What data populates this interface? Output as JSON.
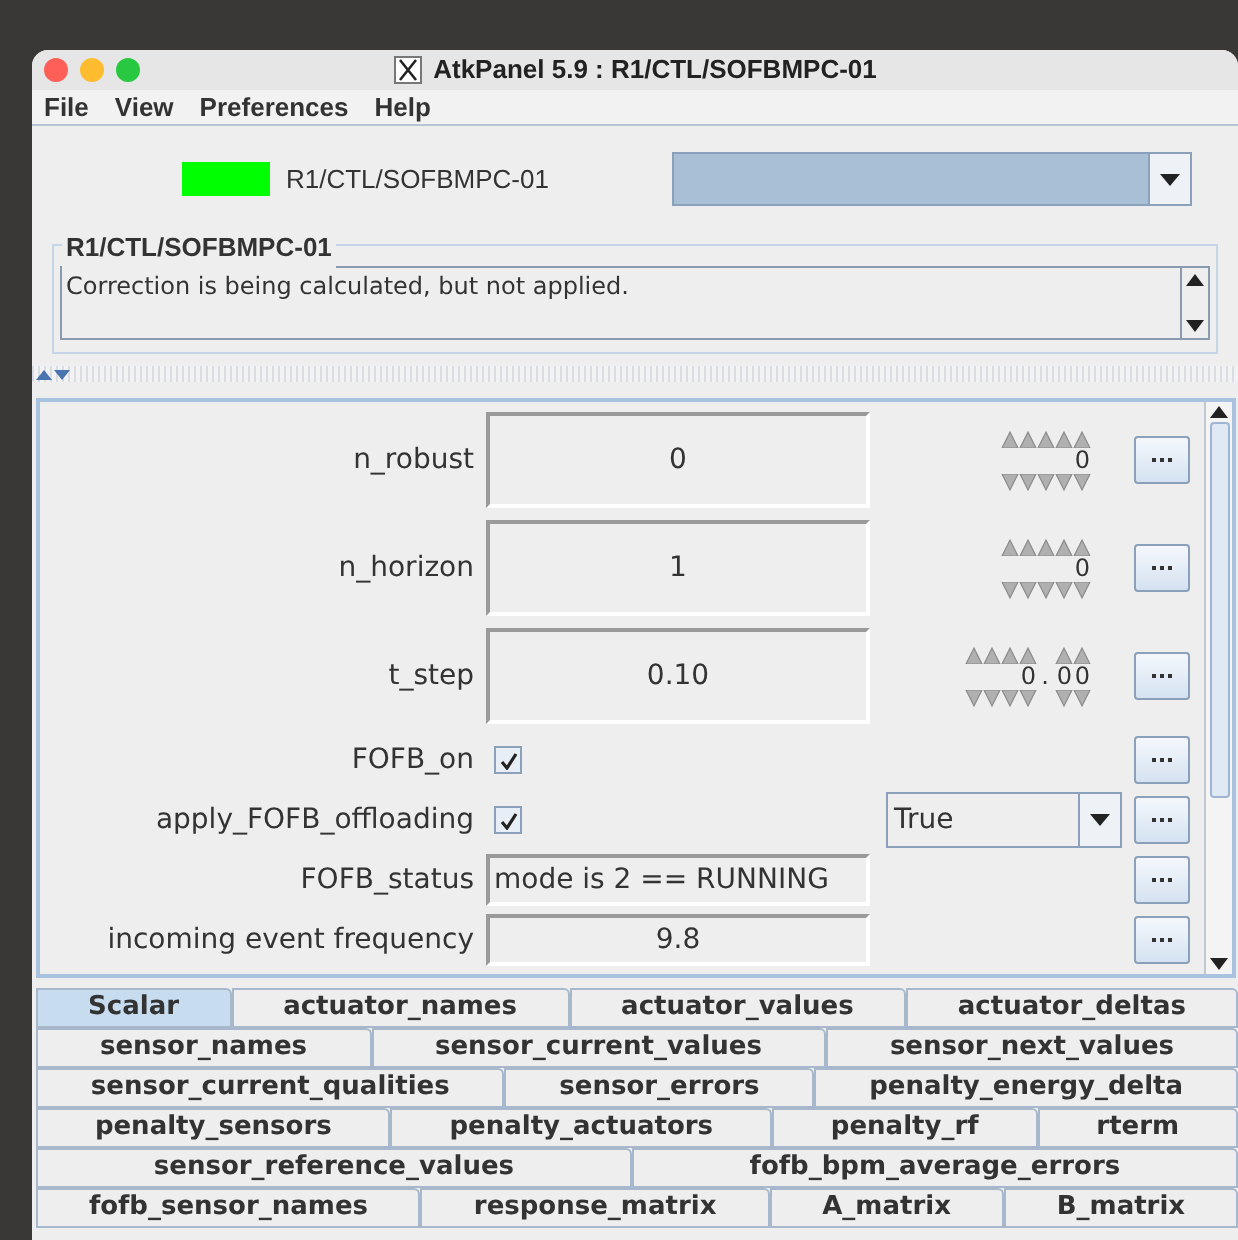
{
  "window": {
    "title": "AtkPanel 5.9 : R1/CTL/SOFBMPC-01"
  },
  "menu": [
    "File",
    "View",
    "Preferences",
    "Help"
  ],
  "device": {
    "name": "R1/CTL/SOFBMPC-01",
    "color": "#00ff00"
  },
  "status_box": {
    "title": "R1/CTL/SOFBMPC-01",
    "text": "Correction is being calculated, but not applied."
  },
  "attributes": [
    {
      "kind": "spin",
      "label": "n_robust",
      "value": "0",
      "editor": {
        "integer": "0"
      }
    },
    {
      "kind": "spin",
      "label": "n_horizon",
      "value": "1",
      "editor": {
        "integer": "0"
      }
    },
    {
      "kind": "spin",
      "label": "t_step",
      "value": "0.10",
      "editor": {
        "integer": "0",
        "separator": ".",
        "fraction": "00"
      }
    },
    {
      "kind": "check",
      "label": "FOFB_on",
      "checked": true
    },
    {
      "kind": "check",
      "label": "apply_FOFB_offloading",
      "checked": true,
      "choice": "True"
    },
    {
      "kind": "text",
      "label": "FOFB_status",
      "value": "mode is 2 == RUNNING"
    },
    {
      "kind": "number",
      "label": "incoming event frequency",
      "value": "9.8"
    }
  ],
  "tab_rows": [
    [
      {
        "label": "Scalar",
        "selected": true
      },
      {
        "label": "actuator_names",
        "selected": false
      },
      {
        "label": "actuator_values",
        "selected": false
      },
      {
        "label": "actuator_deltas",
        "selected": false
      }
    ],
    [
      {
        "label": "sensor_names",
        "selected": false
      },
      {
        "label": "sensor_current_values",
        "selected": false
      },
      {
        "label": "sensor_next_values",
        "selected": false
      }
    ],
    [
      {
        "label": "sensor_current_qualities",
        "selected": false
      },
      {
        "label": "sensor_errors",
        "selected": false
      },
      {
        "label": "penalty_energy_delta",
        "selected": false
      }
    ],
    [
      {
        "label": "penalty_sensors",
        "selected": false
      },
      {
        "label": "penalty_actuators",
        "selected": false
      },
      {
        "label": "penalty_rf",
        "selected": false
      },
      {
        "label": "rterm",
        "selected": false
      }
    ],
    [
      {
        "label": "sensor_reference_values",
        "selected": false
      },
      {
        "label": "fofb_bpm_average_errors",
        "selected": false
      }
    ],
    [
      {
        "label": "fofb_sensor_names",
        "selected": false
      },
      {
        "label": "response_matrix",
        "selected": false
      },
      {
        "label": "A_matrix",
        "selected": false
      },
      {
        "label": "B_matrix",
        "selected": false
      }
    ]
  ]
}
